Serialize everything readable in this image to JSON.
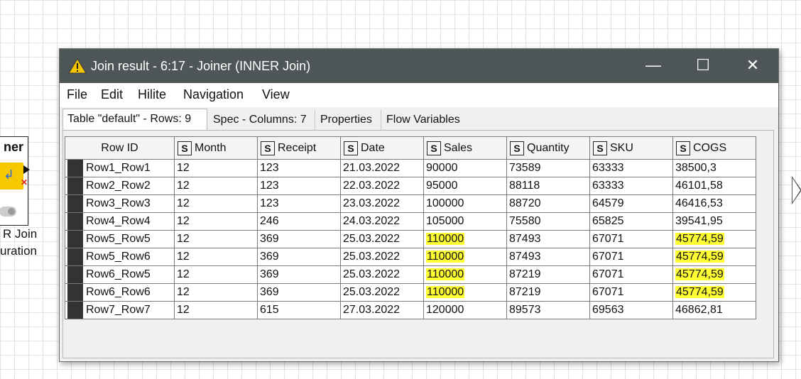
{
  "node": {
    "title": "ner",
    "label_line1": "R Join",
    "label_line2": "uration"
  },
  "window": {
    "title": "Join result - 6:17 - Joiner (INNER Join)",
    "controls": {
      "minimize": "—",
      "maximize": "☐",
      "close": "✕"
    }
  },
  "menu": {
    "items": [
      "File",
      "Edit",
      "Hilite",
      "Navigation",
      "View"
    ]
  },
  "tabs": [
    {
      "label": "Table \"default\" - Rows: 9",
      "active": true
    },
    {
      "label": "Spec - Columns: 7",
      "active": false
    },
    {
      "label": "Properties",
      "active": false
    },
    {
      "label": "Flow Variables",
      "active": false
    }
  ],
  "table": {
    "type_badge": "S",
    "row_id_header": "Row ID",
    "columns": [
      "Month",
      "Receipt",
      "Date",
      "Sales",
      "Quantity",
      "SKU",
      "COGS"
    ],
    "rows": [
      {
        "id": "Row1_Row1",
        "cells": [
          "12",
          "123",
          "21.03.2022",
          "90000",
          "73589",
          "63333",
          "38500,3"
        ],
        "highlight": [
          false,
          false,
          false,
          false,
          false,
          false,
          false
        ]
      },
      {
        "id": "Row2_Row2",
        "cells": [
          "12",
          "123",
          "22.03.2022",
          "95000",
          "88118",
          "63333",
          "46101,58"
        ],
        "highlight": [
          false,
          false,
          false,
          false,
          false,
          false,
          false
        ]
      },
      {
        "id": "Row3_Row3",
        "cells": [
          "12",
          "123",
          "23.03.2022",
          "100000",
          "88720",
          "64579",
          "46416,53"
        ],
        "highlight": [
          false,
          false,
          false,
          false,
          false,
          false,
          false
        ]
      },
      {
        "id": "Row4_Row4",
        "cells": [
          "12",
          "246",
          "24.03.2022",
          "105000",
          "75580",
          "65825",
          "39541,95"
        ],
        "highlight": [
          false,
          false,
          false,
          false,
          false,
          false,
          false
        ]
      },
      {
        "id": "Row5_Row5",
        "cells": [
          "12",
          "369",
          "25.03.2022",
          "110000",
          "87493",
          "67071",
          "45774,59"
        ],
        "highlight": [
          false,
          false,
          false,
          true,
          false,
          false,
          true
        ]
      },
      {
        "id": "Row5_Row6",
        "cells": [
          "12",
          "369",
          "25.03.2022",
          "110000",
          "87493",
          "67071",
          "45774,59"
        ],
        "highlight": [
          false,
          false,
          false,
          true,
          false,
          false,
          true
        ]
      },
      {
        "id": "Row6_Row5",
        "cells": [
          "12",
          "369",
          "25.03.2022",
          "110000",
          "87219",
          "67071",
          "45774,59"
        ],
        "highlight": [
          false,
          false,
          false,
          true,
          false,
          false,
          true
        ]
      },
      {
        "id": "Row6_Row6",
        "cells": [
          "12",
          "369",
          "25.03.2022",
          "110000",
          "87219",
          "67071",
          "45774,59"
        ],
        "highlight": [
          false,
          false,
          false,
          true,
          false,
          false,
          true
        ]
      },
      {
        "id": "Row7_Row7",
        "cells": [
          "12",
          "615",
          "27.03.2022",
          "120000",
          "89573",
          "69563",
          "46862,81"
        ],
        "highlight": [
          false,
          false,
          false,
          false,
          false,
          false,
          false
        ]
      }
    ]
  },
  "colors": {
    "titlebar": "#4f5658",
    "highlight": "#ffff33",
    "warning_icon": "#f5c400"
  }
}
